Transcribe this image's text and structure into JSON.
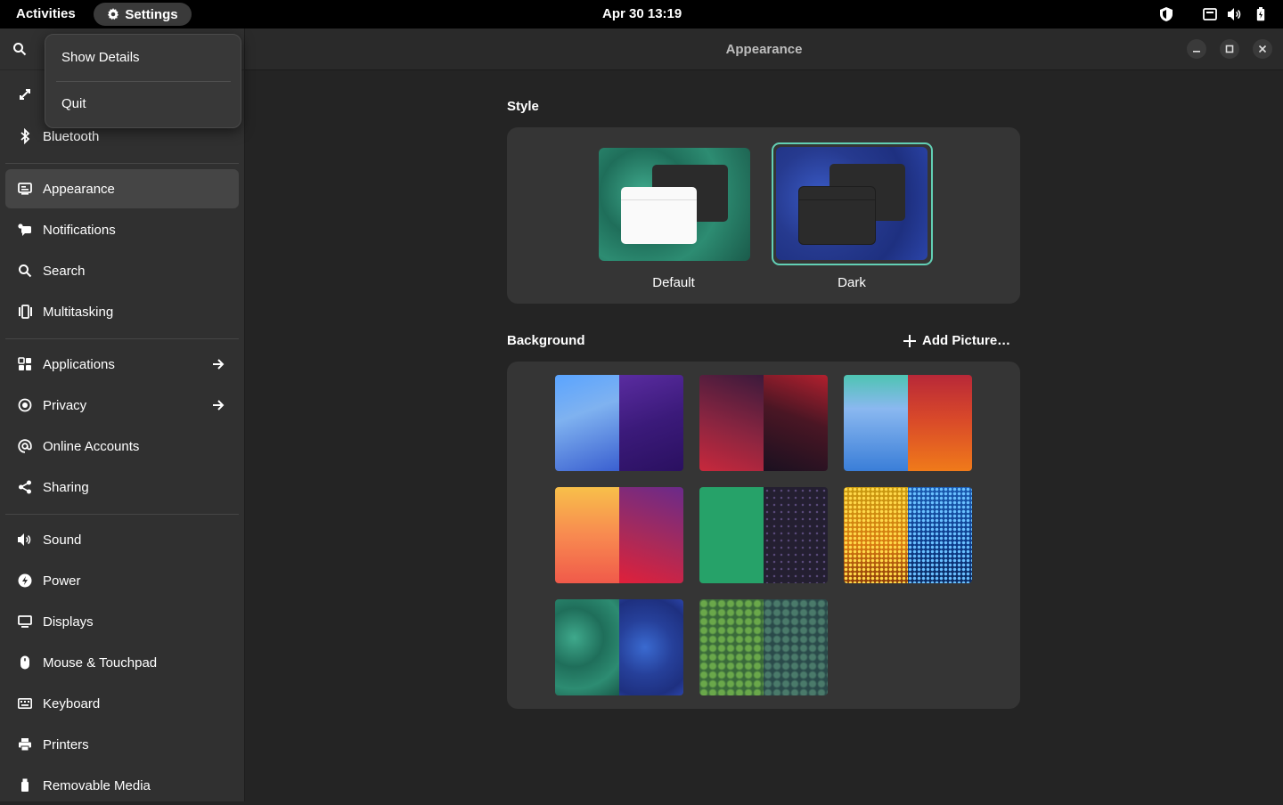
{
  "topbar": {
    "activities": "Activities",
    "app_name": "Settings",
    "clock": "Apr 30  13:19"
  },
  "popover": {
    "items": [
      "Show Details",
      "Quit"
    ]
  },
  "window": {
    "title": "Appearance"
  },
  "sidebar": {
    "items": [
      {
        "label": "Bluetooth",
        "icon": "bluetooth-icon"
      },
      {
        "label": "Appearance",
        "icon": "appearance-icon",
        "active": true
      },
      {
        "label": "Notifications",
        "icon": "notifications-icon"
      },
      {
        "label": "Search",
        "icon": "search-icon"
      },
      {
        "label": "Multitasking",
        "icon": "multitasking-icon"
      },
      {
        "label": "Applications",
        "icon": "applications-icon"
      },
      {
        "label": "Privacy",
        "icon": "privacy-icon"
      },
      {
        "label": "Online Accounts",
        "icon": "online-accounts-icon"
      },
      {
        "label": "Sharing",
        "icon": "sharing-icon"
      },
      {
        "label": "Sound",
        "icon": "sound-icon"
      },
      {
        "label": "Power",
        "icon": "power-icon"
      },
      {
        "label": "Displays",
        "icon": "displays-icon"
      },
      {
        "label": "Mouse & Touchpad",
        "icon": "mouse-icon"
      },
      {
        "label": "Keyboard",
        "icon": "keyboard-icon"
      },
      {
        "label": "Printers",
        "icon": "printer-icon"
      },
      {
        "label": "Removable Media",
        "icon": "removable-media-icon"
      }
    ]
  },
  "style": {
    "title": "Style",
    "options": [
      {
        "label": "Default",
        "selected": false
      },
      {
        "label": "Dark",
        "selected": true
      }
    ],
    "accent": "#62d0b5"
  },
  "background": {
    "title": "Background",
    "add_label": "Add Picture…"
  }
}
